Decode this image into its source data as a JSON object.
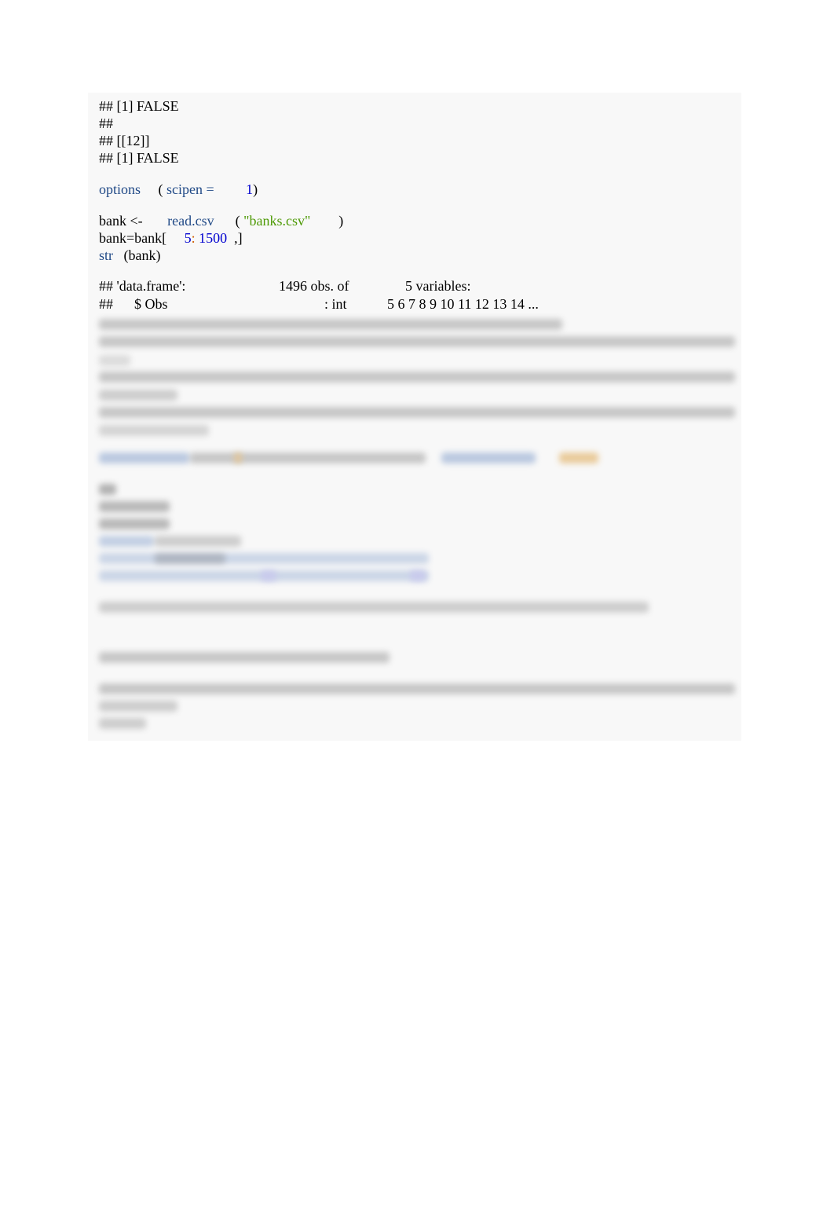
{
  "output_lines": [
    "## [1] FALSE",
    "##",
    "## [[12]]",
    "## [1] FALSE"
  ],
  "code": {
    "options_fn": "options",
    "options_open": "(",
    "options_arg": "scipen =",
    "options_val": "1",
    "options_close": ")",
    "read_assign": "bank <-",
    "read_fn": "read.csv",
    "read_open": "(",
    "read_arg": "\"banks.csv\"",
    "read_close": ")",
    "subset_prefix": "bank=bank[",
    "subset_start": "5",
    "subset_colon": ":",
    "subset_end": "1500",
    "subset_suffix": ",]",
    "str_fn": "str",
    "str_arg": "(bank)"
  },
  "str_output": {
    "header_prefix": "## 'data.frame':",
    "obs": "1496 obs. of",
    "vars": "5 variables:",
    "row1_prefix": "##",
    "row1_name": "$ Obs",
    "row1_type": ": int",
    "row1_values": "5 6 7 8 9 10 11 12 13 14 ..."
  }
}
